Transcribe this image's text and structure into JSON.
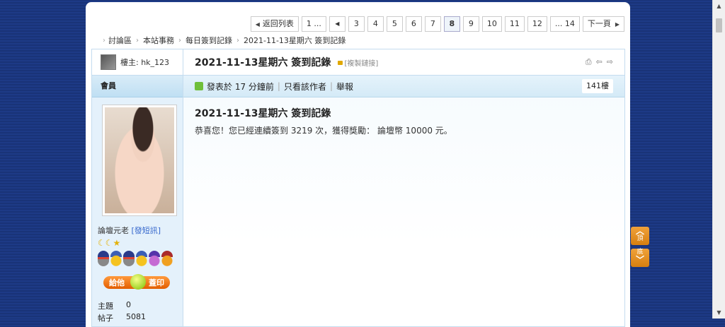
{
  "pager": {
    "back_label": "返回列表",
    "pages": [
      "1 ...",
      "3",
      "4",
      "5",
      "6",
      "7",
      "8",
      "9",
      "10",
      "11",
      "12",
      "... 14"
    ],
    "current": "8",
    "next_label": "下一頁"
  },
  "breadcrumb": [
    "討論區",
    "本站事務",
    "每日簽到記錄",
    "2021-11-13星期六 簽到記錄"
  ],
  "author": {
    "label": "樓主: hk_123"
  },
  "member_label": "會員",
  "post": {
    "title": "2021-11-13星期六 簽到記錄",
    "copy_link": "[複製鏈接]",
    "posted_label": "發表於 17 分鐘前",
    "only_author": "只看該作者",
    "report": "舉報",
    "floor": "141樓",
    "content_title": "2021-11-13星期六 簽到記錄",
    "content_text": "恭喜您！您已經連續簽到 3219 次，獲得獎勵： 論壇幣 10000 元。"
  },
  "profile": {
    "rank": "論壇元老",
    "message_link": "[發短訊]",
    "stars": "☾☾★",
    "stamp_left": "給他",
    "stamp_right": "蓋印",
    "stats": [
      {
        "k": "主題",
        "v": "0"
      },
      {
        "k": "帖子",
        "v": "5081"
      }
    ]
  },
  "float_buttons": {
    "top": "頂",
    "bottom": "底"
  }
}
